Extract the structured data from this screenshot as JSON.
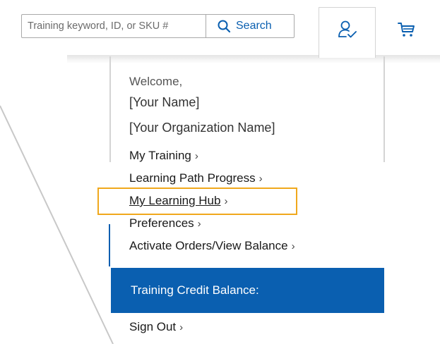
{
  "header": {
    "search_placeholder": "Training keyword, ID, or SKU #",
    "search_value": "",
    "search_button_label": "Search",
    "account_icon": "user-check-icon",
    "cart_icon": "cart-icon"
  },
  "account_menu": {
    "welcome": "Welcome,",
    "user_name": "[Your Name]",
    "org_name": "[Your Organization Name]",
    "items": [
      {
        "label": "My Training"
      },
      {
        "label": "Learning Path Progress"
      },
      {
        "label": "My Learning Hub"
      },
      {
        "label": "Preferences"
      },
      {
        "label": "Activate Orders/View Balance"
      }
    ],
    "chevron": "›",
    "credit_balance_label": "Training Credit Balance:",
    "sign_out_label": "Sign Out"
  },
  "colors": {
    "accent": "#0a5fb0",
    "highlight": "#f0a81c"
  }
}
